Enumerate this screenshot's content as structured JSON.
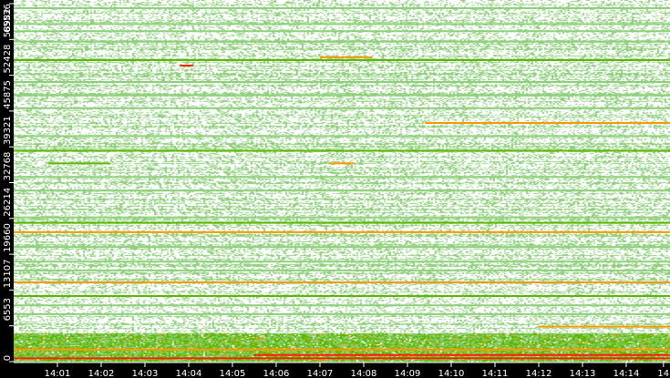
{
  "chart_data": {
    "type": "heatmap",
    "title": "",
    "xlabel": "",
    "ylabel": "",
    "y_ticks": [
      0,
      6553,
      13107,
      19660,
      26214,
      32768,
      39321,
      45875,
      52428,
      58982,
      65536
    ],
    "y_tick_labels": [
      "0",
      "6553",
      "13107",
      "19660",
      "26214",
      "32768",
      "39321",
      "45875",
      "52428",
      "58982",
      "65536"
    ],
    "ylim": [
      0,
      65536
    ],
    "x_tick_labels": [
      "14:01",
      "14:02",
      "14:03",
      "14:04",
      "14:05",
      "14:06",
      "14:07",
      "14:08",
      "14:09",
      "14:10",
      "14:11",
      "14:12",
      "14:13",
      "14:14",
      "14"
    ],
    "xlim_minutes": [
      0.0,
      15.0
    ],
    "x_tick_minutes": [
      1,
      2,
      3,
      4,
      5,
      6,
      7,
      8,
      9,
      10,
      11,
      12,
      13,
      14,
      14.85
    ],
    "colors": {
      "low": "#8fd07c",
      "mid": "#5cb800",
      "high": "#ff9900",
      "max": "#ff2000"
    },
    "bands": [
      {
        "port": 64700,
        "from": 0,
        "to": 15,
        "level": "low"
      },
      {
        "port": 61800,
        "from": 0,
        "to": 15,
        "level": "low"
      },
      {
        "port": 60500,
        "from": 0,
        "to": 15,
        "level": "low"
      },
      {
        "port": 58600,
        "from": 0,
        "to": 15,
        "level": "low"
      },
      {
        "port": 55200,
        "from": 0,
        "to": 15,
        "level": "mid"
      },
      {
        "port": 55700,
        "from": 7.0,
        "to": 8.2,
        "level": "high"
      },
      {
        "port": 54200,
        "from": 3.8,
        "to": 4.1,
        "level": "max"
      },
      {
        "port": 51200,
        "from": 0,
        "to": 15,
        "level": "low"
      },
      {
        "port": 48800,
        "from": 0,
        "to": 15,
        "level": "low"
      },
      {
        "port": 46400,
        "from": 0,
        "to": 15,
        "level": "low"
      },
      {
        "port": 43700,
        "from": 9.4,
        "to": 15,
        "level": "high"
      },
      {
        "port": 41300,
        "from": 0,
        "to": 15,
        "level": "low"
      },
      {
        "port": 38600,
        "from": 0,
        "to": 15,
        "level": "mid"
      },
      {
        "port": 36300,
        "from": 0.8,
        "to": 2.2,
        "level": "mid"
      },
      {
        "port": 36300,
        "from": 7.2,
        "to": 7.8,
        "level": "high"
      },
      {
        "port": 33800,
        "from": 0,
        "to": 15,
        "level": "low"
      },
      {
        "port": 31300,
        "from": 0,
        "to": 15,
        "level": "low"
      },
      {
        "port": 26400,
        "from": 0,
        "to": 15,
        "level": "low"
      },
      {
        "port": 25400,
        "from": 0,
        "to": 15,
        "level": "mid"
      },
      {
        "port": 23700,
        "from": 0,
        "to": 15,
        "level": "high"
      },
      {
        "port": 21000,
        "from": 0,
        "to": 15,
        "level": "low"
      },
      {
        "port": 18300,
        "from": 0,
        "to": 15,
        "level": "low"
      },
      {
        "port": 16700,
        "from": 0,
        "to": 15,
        "level": "low"
      },
      {
        "port": 14500,
        "from": 0,
        "to": 15,
        "level": "high"
      },
      {
        "port": 12000,
        "from": 0,
        "to": 15,
        "level": "mid"
      },
      {
        "port": 10300,
        "from": 0,
        "to": 15,
        "level": "low"
      },
      {
        "port": 8700,
        "from": 0,
        "to": 15,
        "level": "low"
      },
      {
        "port": 6400,
        "from": 12.0,
        "to": 15,
        "level": "high"
      },
      {
        "port": 2200,
        "from": 0,
        "to": 15,
        "level": "high"
      },
      {
        "port": 1200,
        "from": 5.5,
        "to": 15,
        "level": "max"
      },
      {
        "port": 600,
        "from": 0,
        "to": 15,
        "level": "max"
      }
    ],
    "dense_region": {
      "port_from": 0,
      "port_to": 5200,
      "level": "mid"
    }
  }
}
